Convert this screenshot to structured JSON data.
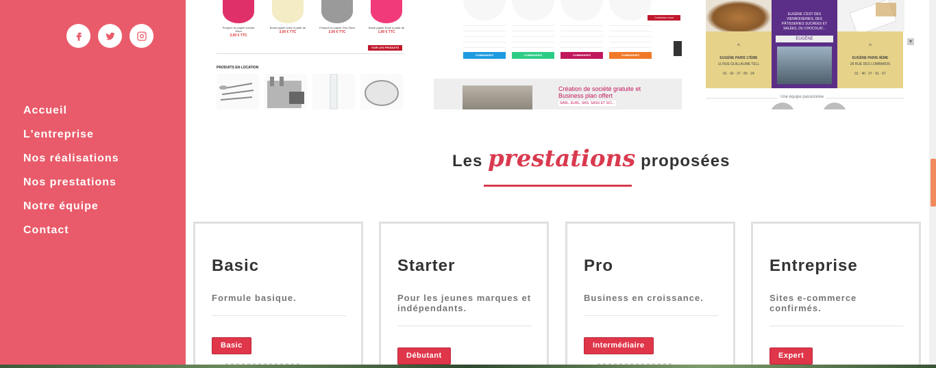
{
  "sidebar": {
    "social": [
      {
        "icon": "facebook-icon",
        "label": "f"
      },
      {
        "icon": "twitter-icon",
        "label": "t"
      },
      {
        "icon": "instagram-icon",
        "label": "ig"
      }
    ],
    "nav": [
      {
        "label": "Accueil"
      },
      {
        "label": "L'entreprise"
      },
      {
        "label": "Nos réalisations"
      },
      {
        "label": "Nos prestations"
      },
      {
        "label": "Notre équipe"
      },
      {
        "label": "Contact"
      }
    ]
  },
  "portfolio": {
    "shop": {
      "products": [
        {
          "name": "Pompon en papier fuschia 25cm",
          "price": "2,00 € TTC",
          "color": "#e0306a"
        },
        {
          "name": "Boule papier ivoire à partir de",
          "price": "3,00 € TTC",
          "color": "#f3ecc4"
        },
        {
          "name": "Pompon en papier Gris 25cm",
          "price": "2,00 € TTC",
          "color": "#9a9a9a"
        },
        {
          "name": "Boule papier Rose à partir de",
          "price": "1,90 € TTC",
          "color": "#f03a7a"
        }
      ],
      "more_button": "VOIR LES PRODUITS",
      "location_title": "PRODUITS EN LOCATION"
    },
    "company": {
      "contact_tag": "Contactez-nous",
      "plans": [
        {
          "button": "COMMANDEZ",
          "color": "#1e9be0"
        },
        {
          "button": "COMMANDEZ",
          "color": "#2ecc87"
        },
        {
          "button": "COMMANDEZ",
          "color": "#c0185a"
        },
        {
          "button": "COMMANDEZ",
          "color": "#f07a2a"
        }
      ],
      "banner_title": "Création de société gratuite et Business plan offert",
      "banner_sub": "SARL, EURL, SAS, SASU ET SCI..."
    },
    "bakery": {
      "purple_text": "EUGÈNE C'EST DES VIENNOISERIES, DES PÂTISSERIES SUCRÉES ET SALÉES, DU CHOCOLAT...",
      "store_sign": "EUGÈNE",
      "left": {
        "chevron": "^",
        "name": "EUGÈNE PARIS 17ÈME",
        "addr": "11 RUE GUILLAUME TELL",
        "tel": "01 · 42 · 27 · 65 · 24"
      },
      "right": {
        "chevron": "^",
        "name": "EUGÈNE PARIS 4ÈME",
        "addr": "28 RUE DES LOMBARDS",
        "tel": "01 · 40 · 27 · 91 · 67"
      },
      "team_label": "Une équipe passionnée"
    }
  },
  "section": {
    "title_before": "Les",
    "title_script": "prestations",
    "title_after": "proposées"
  },
  "cards": [
    {
      "title": "Basic",
      "desc": "Formule basique.",
      "badge": "Basic"
    },
    {
      "title": "Starter",
      "desc": "Pour les jeunes marques et indépendants.",
      "badge": "Débutant"
    },
    {
      "title": "Pro",
      "desc": "Business en croissance.",
      "badge": "Intermédiaire"
    },
    {
      "title": "Entreprise",
      "desc": "Sites e-commerce confirmés.",
      "badge": "Expert"
    }
  ],
  "colors": {
    "sidebar_bg": "#e95b6a",
    "accent": "#d93a4f",
    "badge": "#e0364a",
    "scroll_thumb": "#f08a5d"
  }
}
